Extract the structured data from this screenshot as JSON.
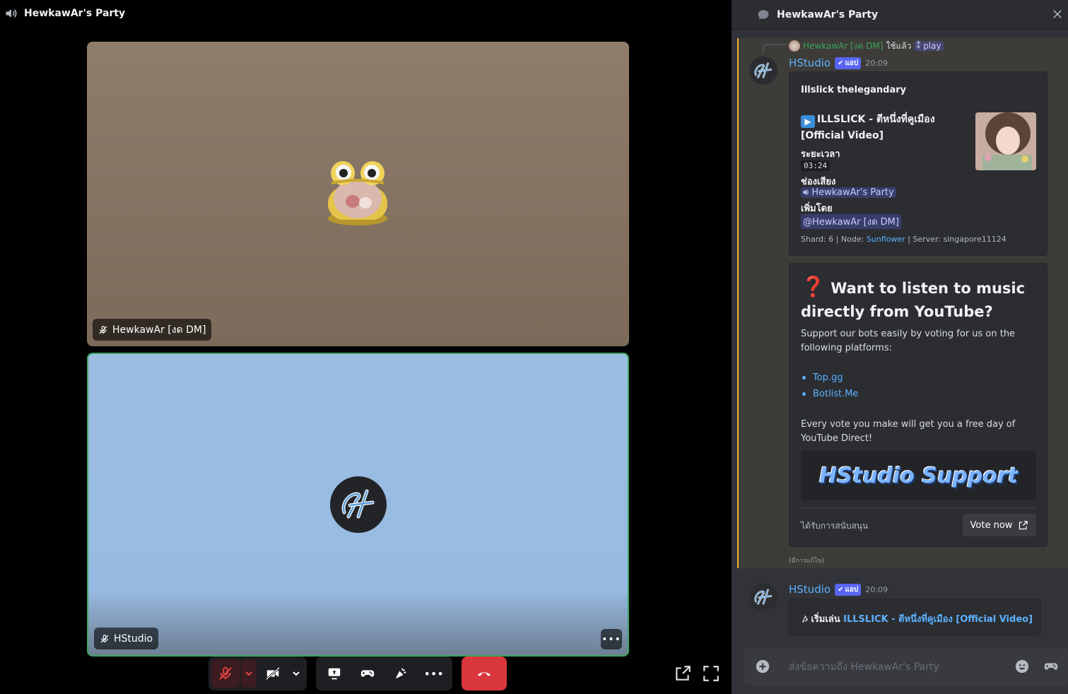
{
  "call": {
    "title": "HewkawAr's Party",
    "tiles": [
      {
        "name": "HewkawAr [งด DM]"
      },
      {
        "name": "HStudio"
      }
    ]
  },
  "chat": {
    "header_title": "HewkawAr's Party",
    "reply": {
      "author": "HewkawAr [งด DM]",
      "action": "ใช้แล้ว",
      "command": "play"
    },
    "messages": [
      {
        "author": "HStudio",
        "app_tag": "แอป",
        "time": "20:09",
        "embed_now": {
          "author": "Illslick thelegandary",
          "title": "ILLSLICK - ตีหนึ่งที่คูเมือง [Official Video]",
          "duration_label": "ระยะเวลา",
          "duration": "03:24",
          "channel_label": "ช่องเสียง",
          "channel": "HewkawAr's Party",
          "added_by_label": "เพิ่มโดย",
          "added_by": "@HewkawAr [งด DM]",
          "footer_prefix": "Shard: 6 | Node:",
          "footer_node": "Sunflower",
          "footer_suffix": "| Server: singapore11124"
        },
        "embed_promo": {
          "title": "Want to listen to music directly from YouTube?",
          "text1": "Support our bots easily by voting for us on the following platforms:",
          "links": [
            "Top.gg",
            "Botlist.Me"
          ],
          "text2": "Every vote you make will get you a free day of YouTube Direct!",
          "banner": "HStudio Support",
          "footer": "ได้รับการสนับสนุน",
          "button": "Vote now"
        },
        "edited": "(มีการแก้ไข)"
      },
      {
        "author": "HStudio",
        "app_tag": "แอป",
        "time": "20:09",
        "now_playing_prefix": "เริ่มเล่น",
        "now_playing_song": "ILLSLICK - ตีหนึ่งที่คูเมือง [Official Video]"
      }
    ],
    "composer_placeholder": "ส่งข้อความถึง HewkawAr's Party"
  },
  "colors": {
    "accent": "#5865f2",
    "link": "#5db1ff",
    "speaking_border": "#3ba55d",
    "hangup": "#da373c",
    "highlight_bar": "#f0b232"
  },
  "icons": [
    "speaker-icon",
    "mic-muted-icon",
    "camera-off-icon",
    "screen-share-icon",
    "activity-icon",
    "soundboard-icon",
    "more-icon",
    "hang-up-icon",
    "popout-icon",
    "fullscreen-icon",
    "thread-icon",
    "close-icon",
    "plus-icon",
    "emoji-icon",
    "game-icon",
    "external-link-icon"
  ]
}
